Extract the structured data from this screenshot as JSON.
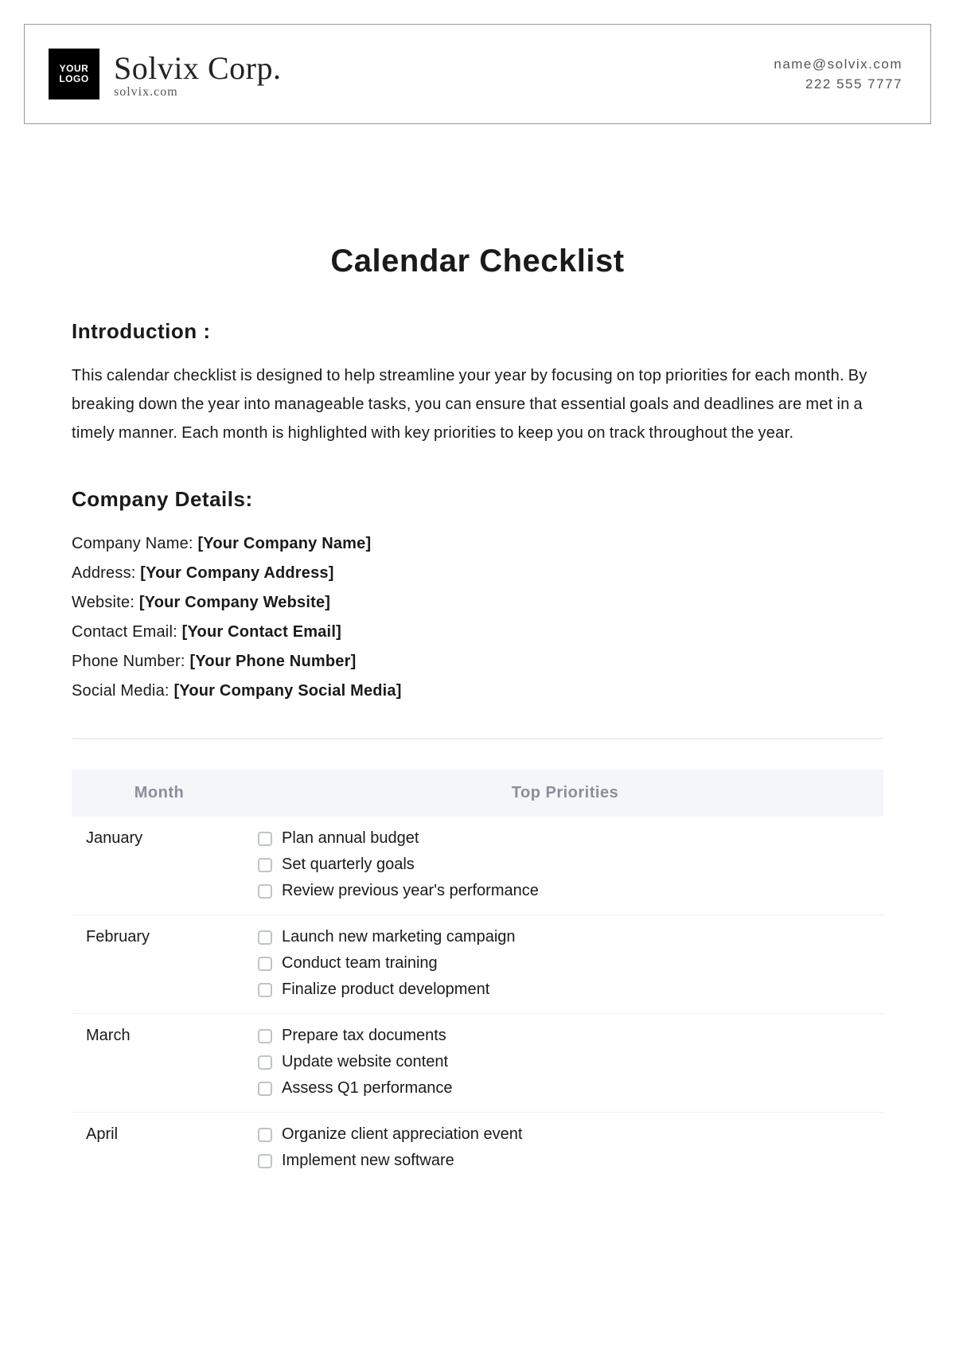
{
  "header": {
    "logo_text": "YOUR\nLOGO",
    "company_name": "Solvix Corp.",
    "company_site": "solvix.com",
    "contact_email": "name@solvix.com",
    "contact_phone": "222 555 7777"
  },
  "title": "Calendar Checklist",
  "intro": {
    "heading": "Introduction :",
    "body": "This calendar checklist is designed to help streamline your year by focusing on top priorities for each month. By breaking down the year into manageable tasks, you can ensure that essential goals and deadlines are met in a timely manner. Each month is highlighted with key priorities to keep you on track throughout the year."
  },
  "company_details": {
    "heading": "Company Details:",
    "fields": [
      {
        "label": "Company Name:",
        "value": "[Your Company Name]"
      },
      {
        "label": "Address:",
        "value": "[Your Company Address]"
      },
      {
        "label": "Website:",
        "value": "[Your Company Website]"
      },
      {
        "label": "Contact Email:",
        "value": "[Your Contact Email]"
      },
      {
        "label": "Phone Number:",
        "value": "[Your Phone Number]"
      },
      {
        "label": "Social Media:",
        "value": "[Your Company Social Media]"
      }
    ]
  },
  "table": {
    "headers": {
      "month": "Month",
      "priorities": "Top Priorities"
    },
    "rows": [
      {
        "month": "January",
        "priorities": [
          "Plan annual budget",
          "Set quarterly goals",
          "Review previous year's performance"
        ]
      },
      {
        "month": "February",
        "priorities": [
          "Launch new marketing campaign",
          "Conduct team training",
          "Finalize product development"
        ]
      },
      {
        "month": "March",
        "priorities": [
          "Prepare tax documents",
          "Update website content",
          "Assess Q1 performance"
        ]
      },
      {
        "month": "April",
        "priorities": [
          "Organize client appreciation event",
          "Implement new software"
        ]
      }
    ]
  }
}
